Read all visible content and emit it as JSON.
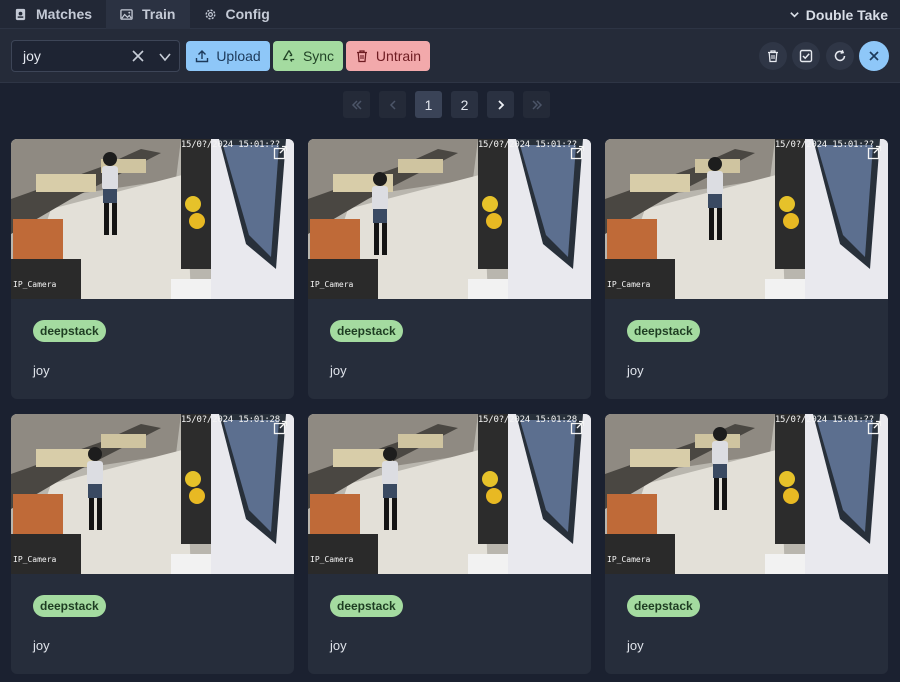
{
  "nav": {
    "tabs": [
      {
        "label": "Matches",
        "icon": "id-card-icon"
      },
      {
        "label": "Train",
        "icon": "image-icon"
      },
      {
        "label": "Config",
        "icon": "gear-icon"
      }
    ],
    "active_tab": "Train",
    "right_label": "Double Take"
  },
  "toolbar": {
    "select_value": "joy",
    "upload_label": "Upload",
    "sync_label": "Sync",
    "untrain_label": "Untrain",
    "colors": {
      "upload": "#8ec7f8",
      "sync": "#a4dba0",
      "untrain": "#f2a9ab"
    }
  },
  "pagination": {
    "pages": [
      "1",
      "2"
    ],
    "current": "1"
  },
  "cards": [
    {
      "timestamp": "15/0?/2024 15:01:??",
      "camera_label": "IP_Camera",
      "detector": "deepstack",
      "name": "joy"
    },
    {
      "timestamp": "15/0?/2024 15:01:??",
      "camera_label": "IP_Camera",
      "detector": "deepstack",
      "name": "joy"
    },
    {
      "timestamp": "15/0?/2024 15:01:??",
      "camera_label": "IP_Camera",
      "detector": "deepstack",
      "name": "joy"
    },
    {
      "timestamp": "15/0?/2024 15:01:28",
      "camera_label": "IP_Camera",
      "detector": "deepstack",
      "name": "joy"
    },
    {
      "timestamp": "15/0?/2024 15:01:28",
      "camera_label": "IP_Camera",
      "detector": "deepstack",
      "name": "joy"
    },
    {
      "timestamp": "15/0?/2024 15:01:??",
      "camera_label": "IP_Camera",
      "detector": "deepstack",
      "name": "joy"
    }
  ]
}
